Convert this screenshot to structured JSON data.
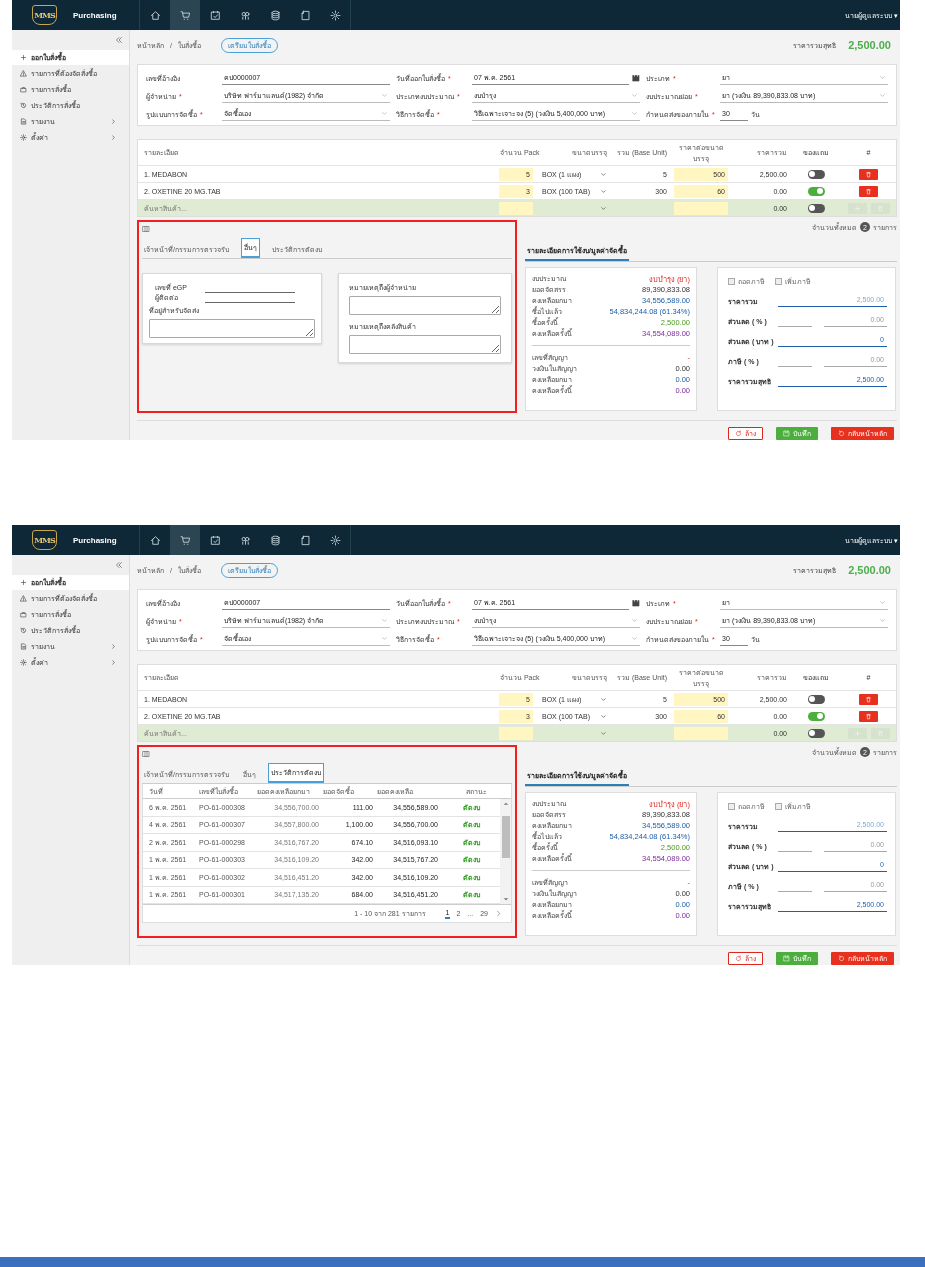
{
  "screens": [
    {
      "header": {
        "logo": "MMS",
        "app": "Purchasing",
        "nav": [
          {
            "selected": false
          },
          {
            "selected": true
          },
          {
            "selected": false
          },
          {
            "selected": false
          },
          {
            "selected": false
          },
          {
            "selected": false
          },
          {
            "selected": false
          }
        ],
        "user": "นายผู้ดูแลระบบ ▾"
      },
      "sidebar": {
        "items": [
          {
            "label": "ออกใบสั่งซื้อ",
            "selected": true
          },
          {
            "label": "รายการที่ต้องจัดสั่งซื้อ",
            "selected": false
          },
          {
            "label": "รายการสั่งซื้อ",
            "selected": false
          },
          {
            "label": "ประวัติการสั่งซื้อ",
            "selected": false
          },
          {
            "label": "รายงาน",
            "selected": false,
            "expanded": false
          },
          {
            "label": "ตั้งค่า",
            "selected": false,
            "expanded": false
          }
        ]
      },
      "breadcrumb": [
        "หน้าหลัก",
        "ใบสั่งซื้อ"
      ],
      "breadcrumb_separator": "/",
      "status_badge": "เตรียมใบสั่งซื้อ",
      "total_label": "ราคารวมสุทธิ",
      "total": "2,500.00",
      "form": [
        {
          "label": "เลขที่อ้างอิง",
          "kind": "text",
          "value": "คป0000007"
        },
        {
          "label": "วันที่ออกใบสั่งซื้อ",
          "mark": "*",
          "kind": "date",
          "value": "07 พ.ค. 2561"
        },
        {
          "label": "ประเภท",
          "mark": "*",
          "kind": "select",
          "value": "ยา"
        },
        {
          "label": "ผู้จำหน่าย",
          "mark": "*",
          "kind": "select",
          "value": "บริษัท ฟาร์มาแลนด์(1982) จำกัด"
        },
        {
          "label": "ประเภทงบประมาณ",
          "mark": "*",
          "kind": "select",
          "value": "งบบำรุง"
        },
        {
          "label": "งบประมาณย่อย",
          "mark": "*",
          "kind": "select",
          "value": "ยา (วงเงิน 89,390,833.08 บาท)"
        },
        {
          "label": "รูปแบบการจัดซื้อ",
          "mark": "*",
          "kind": "select",
          "value": "จัดซื้อเอง"
        },
        {
          "label": "วิธีการจัดซื้อ",
          "mark": "*",
          "kind": "select",
          "value": "วิธีเฉพาะเจาะจง (5) (วงเงิน 5,400,000 บาท)"
        },
        {
          "label": "กำหนดส่งของภายใน",
          "mark": "*",
          "kind": "days",
          "value": "30",
          "unit": "วัน"
        }
      ],
      "items": {
        "columns": [
          "รายละเอียด",
          "จำนวน Pack",
          "ขนาดบรรจุ",
          "รวม (Base Unit)",
          "ราคาต่อขนาดบรรจุ",
          "ราคารวม",
          "ของแถม",
          "#"
        ],
        "rows": [
          {
            "name": "1. MEDABON",
            "qty": "5",
            "pack": "BOX (1 แผง)",
            "base": "5",
            "price": "500",
            "total": "2,500.00",
            "free": false
          },
          {
            "name": "2. OXETINE 20 MG.TAB",
            "qty": "3",
            "pack": "BOX (100 TAB)",
            "base": "300",
            "price": "60",
            "total": "0.00",
            "free": true
          }
        ],
        "search_row": {
          "placeholder": "ค้นหาสินค้า...",
          "total": "0.00",
          "free": false,
          "disabled": true
        },
        "count_label": "จำนวนทั้งหมด",
        "count": "2",
        "count_unit": "รายการ"
      },
      "tabs": [
        {
          "label": "เจ้าหน้าที่/กรรมการตรวจรับ",
          "selected": false
        },
        {
          "label": "อื่นๆ",
          "selected": true
        },
        {
          "label": "ประวัติการตัดงบ",
          "selected": false
        }
      ],
      "panel": {
        "kind": "other",
        "highlighted": true,
        "fields": [
          "เลขที่ eGP",
          "ผู้ติดต่อ"
        ],
        "address_label": "ที่อยู่สำหรับจัดส่ง",
        "notes": [
          "หมายเหตุถึงผู้จำหน่าย",
          "หมายเหตุถึงคลังสินค้า"
        ]
      },
      "budget": {
        "tab": "รายละเอียดการใช้งบ/มูลค่าจัดซื้อ",
        "groups": [
          [
            {
              "label": "งบประมาณ",
              "value": "งบบำรุง (ยา)",
              "kind": "budget"
            },
            {
              "label": "ยอดจัดสรร",
              "value": "89,390,833.08",
              "kind": "allocated"
            },
            {
              "label": "คงเหลือยกมา",
              "value": "34,556,589.00",
              "kind": "carried"
            },
            {
              "label": "ซื้อไปแล้ว",
              "value": "54,834,244.08 (61.34%)",
              "kind": "spent"
            },
            {
              "label": "ซื้อครั้งนี้",
              "value": "2,500.00",
              "kind": "current"
            },
            {
              "label": "คงเหลือครั้งนี้",
              "value": "34,554,089.00",
              "kind": "remaining"
            }
          ],
          [
            {
              "label": "เลขที่สัญญา",
              "value": "-",
              "kind": "contract"
            },
            {
              "label": "วงเงินในสัญญา",
              "value": "0.00",
              "kind": "plain"
            },
            {
              "label": "คงเหลือยกมา",
              "value": "0.00",
              "kind": "carried"
            },
            {
              "label": "คงเหลือครั้งนี้",
              "value": "0.00",
              "kind": "remaining"
            }
          ]
        ]
      },
      "pricing": {
        "checks": [
          {
            "label": "ถอดภาษี",
            "checked": false
          },
          {
            "label": "เพิ่มภาษี",
            "checked": false
          }
        ],
        "rows": [
          {
            "label": "ราคารวม",
            "kind": "subtotal",
            "value": "2,500.00"
          },
          {
            "label": "ส่วนลด ( % )",
            "kind": "percent",
            "value": "0.00"
          },
          {
            "label": "ส่วนลด ( บาท )",
            "kind": "amount",
            "value": "0"
          },
          {
            "label": "ภาษี ( % )",
            "kind": "percent",
            "value": "0.00"
          },
          {
            "label": "ราคารวมสุทธิ",
            "kind": "net",
            "value": "2,500.00"
          }
        ]
      },
      "buttons": [
        {
          "label": "ล้าง",
          "kind": "reset"
        },
        {
          "label": "บันทึก",
          "kind": "save"
        },
        {
          "label": "กลับหน้าหลัก",
          "kind": "back"
        }
      ]
    },
    {
      "header": {
        "logo": "MMS",
        "app": "Purchasing",
        "nav": [
          {
            "selected": false
          },
          {
            "selected": true
          },
          {
            "selected": false
          },
          {
            "selected": false
          },
          {
            "selected": false
          },
          {
            "selected": false
          },
          {
            "selected": false
          }
        ],
        "user": "นายผู้ดูแลระบบ ▾"
      },
      "sidebar": {
        "items": [
          {
            "label": "ออกใบสั่งซื้อ",
            "selected": true
          },
          {
            "label": "รายการที่ต้องจัดสั่งซื้อ",
            "selected": false
          },
          {
            "label": "รายการสั่งซื้อ",
            "selected": false
          },
          {
            "label": "ประวัติการสั่งซื้อ",
            "selected": false
          },
          {
            "label": "รายงาน",
            "selected": false,
            "expanded": false
          },
          {
            "label": "ตั้งค่า",
            "selected": false,
            "expanded": false
          }
        ]
      },
      "breadcrumb": [
        "หน้าหลัก",
        "ใบสั่งซื้อ"
      ],
      "breadcrumb_separator": "/",
      "status_badge": "เตรียมใบสั่งซื้อ",
      "total_label": "ราคารวมสุทธิ",
      "total": "2,500.00",
      "form": [
        {
          "label": "เลขที่อ้างอิง",
          "kind": "text",
          "value": "คป0000007"
        },
        {
          "label": "วันที่ออกใบสั่งซื้อ",
          "mark": "*",
          "kind": "date",
          "value": "07 พ.ค. 2561"
        },
        {
          "label": "ประเภท",
          "mark": "*",
          "kind": "select",
          "value": "ยา"
        },
        {
          "label": "ผู้จำหน่าย",
          "mark": "*",
          "kind": "select",
          "value": "บริษัท ฟาร์มาแลนด์(1982) จำกัด"
        },
        {
          "label": "ประเภทงบประมาณ",
          "mark": "*",
          "kind": "select",
          "value": "งบบำรุง"
        },
        {
          "label": "งบประมาณย่อย",
          "mark": "*",
          "kind": "select",
          "value": "ยา (วงเงิน 89,390,833.08 บาท)"
        },
        {
          "label": "รูปแบบการจัดซื้อ",
          "mark": "*",
          "kind": "select",
          "value": "จัดซื้อเอง"
        },
        {
          "label": "วิธีการจัดซื้อ",
          "mark": "*",
          "kind": "select",
          "value": "วิธีเฉพาะเจาะจง (5) (วงเงิน 5,400,000 บาท)"
        },
        {
          "label": "กำหนดส่งของภายใน",
          "mark": "*",
          "kind": "days",
          "value": "30",
          "unit": "วัน"
        }
      ],
      "items": {
        "columns": [
          "รายละเอียด",
          "จำนวน Pack",
          "ขนาดบรรจุ",
          "รวม (Base Unit)",
          "ราคาต่อขนาดบรรจุ",
          "ราคารวม",
          "ของแถม",
          "#"
        ],
        "rows": [
          {
            "name": "1. MEDABON",
            "qty": "5",
            "pack": "BOX (1 แผง)",
            "base": "5",
            "price": "500",
            "total": "2,500.00",
            "free": false
          },
          {
            "name": "2. OXETINE 20 MG.TAB",
            "qty": "3",
            "pack": "BOX (100 TAB)",
            "base": "300",
            "price": "60",
            "total": "0.00",
            "free": true
          }
        ],
        "search_row": {
          "placeholder": "ค้นหาสินค้า...",
          "total": "0.00",
          "free": false,
          "disabled": true
        },
        "count_label": "จำนวนทั้งหมด",
        "count": "2",
        "count_unit": "รายการ"
      },
      "tabs": [
        {
          "label": "เจ้าหน้าที่/กรรมการตรวจรับ",
          "selected": false
        },
        {
          "label": "อื่นๆ",
          "selected": false
        },
        {
          "label": "ประวัติการตัดงบ",
          "selected": true
        }
      ],
      "panel": {
        "kind": "history",
        "highlighted": true,
        "columns": [
          "วันที่",
          "เลขที่ใบสั่งซื้อ",
          "ยอดคงเหลือยกมา",
          "ยอดจัดซื้อ",
          "ยอดคงเหลือ",
          "สถานะ"
        ],
        "rows": [
          {
            "date": "6 พ.ค. 2561",
            "po": "PO-61-000308",
            "brought": "34,556,700.00",
            "amount": "111.00",
            "balance": "34,556,589.00",
            "status": "ตัดงบ"
          },
          {
            "date": "4 พ.ค. 2561",
            "po": "PO-61-000307",
            "brought": "34,557,800.00",
            "amount": "1,100.00",
            "balance": "34,556,700.00",
            "status": "ตัดงบ"
          },
          {
            "date": "2 พ.ค. 2561",
            "po": "PO-61-000298",
            "brought": "34,516,767.20",
            "amount": "674.10",
            "balance": "34,516,093.10",
            "status": "ตัดงบ"
          },
          {
            "date": "1 พ.ค. 2561",
            "po": "PO-61-000303",
            "brought": "34,516,109.20",
            "amount": "342.00",
            "balance": "34,515,767.20",
            "status": "ตัดงบ"
          },
          {
            "date": "1 พ.ค. 2561",
            "po": "PO-61-000302",
            "brought": "34,516,451.20",
            "amount": "342.00",
            "balance": "34,516,109.20",
            "status": "ตัดงบ"
          },
          {
            "date": "1 พ.ค. 2561",
            "po": "PO-61-000301",
            "brought": "34,517,135.20",
            "amount": "684.00",
            "balance": "34,516,451.20",
            "status": "ตัดงบ"
          }
        ],
        "range": "1 - 10 จาก 281 รายการ",
        "pages": [
          {
            "label": "1",
            "selected": true
          },
          {
            "label": "2",
            "selected": false
          },
          {
            "label": "...",
            "selected": false
          },
          {
            "label": "29",
            "selected": false
          }
        ]
      },
      "budget": {
        "tab": "รายละเอียดการใช้งบ/มูลค่าจัดซื้อ",
        "groups": [
          [
            {
              "label": "งบประมาณ",
              "value": "งบบำรุง (ยา)",
              "kind": "budget"
            },
            {
              "label": "ยอดจัดสรร",
              "value": "89,390,833.08",
              "kind": "allocated"
            },
            {
              "label": "คงเหลือยกมา",
              "value": "34,556,589.00",
              "kind": "carried"
            },
            {
              "label": "ซื้อไปแล้ว",
              "value": "54,834,244.08 (61.34%)",
              "kind": "spent"
            },
            {
              "label": "ซื้อครั้งนี้",
              "value": "2,500.00",
              "kind": "current"
            },
            {
              "label": "คงเหลือครั้งนี้",
              "value": "34,554,089.00",
              "kind": "remaining"
            }
          ],
          [
            {
              "label": "เลขที่สัญญา",
              "value": "-",
              "kind": "contract"
            },
            {
              "label": "วงเงินในสัญญา",
              "value": "0.00",
              "kind": "plain"
            },
            {
              "label": "คงเหลือยกมา",
              "value": "0.00",
              "kind": "carried"
            },
            {
              "label": "คงเหลือครั้งนี้",
              "value": "0.00",
              "kind": "remaining"
            }
          ]
        ]
      },
      "pricing": {
        "checks": [
          {
            "label": "ถอดภาษี",
            "checked": false
          },
          {
            "label": "เพิ่มภาษี",
            "checked": false
          }
        ],
        "rows": [
          {
            "label": "ราคารวม",
            "kind": "subtotal",
            "value": "2,500.00"
          },
          {
            "label": "ส่วนลด ( % )",
            "kind": "percent",
            "value": "0.00"
          },
          {
            "label": "ส่วนลด ( บาท )",
            "kind": "amount",
            "value": "0"
          },
          {
            "label": "ภาษี ( % )",
            "kind": "percent",
            "value": "0.00"
          },
          {
            "label": "ราคารวมสุทธิ",
            "kind": "net",
            "value": "2,500.00"
          }
        ]
      },
      "buttons": [
        {
          "label": "ล้าง",
          "kind": "reset"
        },
        {
          "label": "บันทึก",
          "kind": "save"
        },
        {
          "label": "กลับหน้าหลัก",
          "kind": "back"
        }
      ]
    }
  ]
}
